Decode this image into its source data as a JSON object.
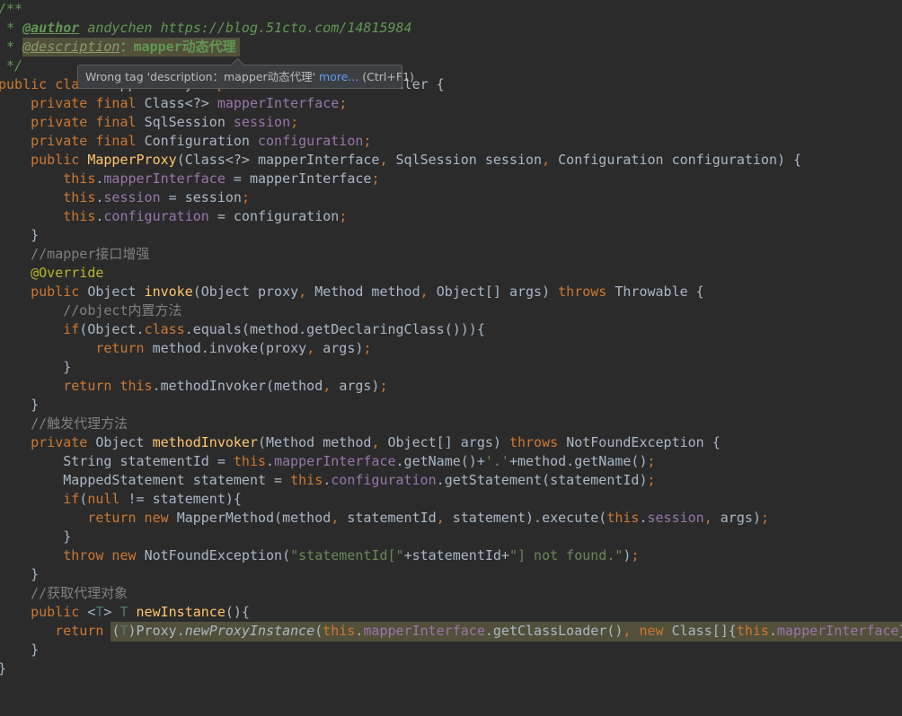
{
  "colors": {
    "background": "#2b2b2b",
    "keyword": "#cc7832",
    "field": "#9876aa",
    "comment": "#808080",
    "doc_comment": "#629755",
    "string": "#6a8759",
    "method_declaration": "#ffc66d",
    "annotation": "#bbb529",
    "text": "#a9b7c6",
    "type_parameter": "#507874",
    "highlight": "#52503a"
  },
  "tooltip": {
    "message": "Wrong tag 'description：mapper动态代理' ",
    "more_link": "more...",
    "shortcut": " (Ctrl+F1)"
  },
  "code_lines": [
    [
      [
        "doc",
        "/**"
      ]
    ],
    [
      [
        "doc",
        " * "
      ],
      [
        "doctag",
        "@author"
      ],
      [
        "doc",
        " andychen https://blog.51cto.com/14815984"
      ]
    ],
    [
      [
        "doc",
        " * "
      ],
      [
        "doctagw",
        "@description"
      ],
      [
        "docw",
        "：mapper动态代理"
      ]
    ],
    [
      [
        "doc",
        " */"
      ]
    ],
    [
      [
        "kw",
        "public class "
      ],
      [
        "tx",
        "MapperProxy "
      ],
      [
        "kw",
        "implements "
      ],
      [
        "tx",
        "InvocationHandler {"
      ]
    ],
    [
      [
        "kw",
        "    private final "
      ],
      [
        "tx",
        "Class<?> "
      ],
      [
        "fld",
        "mapperInterface"
      ],
      [
        "kw",
        ";"
      ]
    ],
    [
      [
        "kw",
        "    private final "
      ],
      [
        "tx",
        "SqlSession "
      ],
      [
        "fld",
        "session"
      ],
      [
        "kw",
        ";"
      ]
    ],
    [
      [
        "kw",
        "    private final "
      ],
      [
        "tx",
        "Configuration "
      ],
      [
        "fld",
        "configuration"
      ],
      [
        "kw",
        ";"
      ]
    ],
    [
      [
        "kw",
        "    public "
      ],
      [
        "fn",
        "MapperProxy"
      ],
      [
        "tx",
        "(Class<?> mapperInterface"
      ],
      [
        "kw",
        ", "
      ],
      [
        "tx",
        "SqlSession session"
      ],
      [
        "kw",
        ", "
      ],
      [
        "tx",
        "Configuration configuration) {"
      ]
    ],
    [
      [
        "kw",
        "        this"
      ],
      [
        "tx",
        "."
      ],
      [
        "fld",
        "mapperInterface "
      ],
      [
        "tx",
        "= mapperInterface"
      ],
      [
        "kw",
        ";"
      ]
    ],
    [
      [
        "kw",
        "        this"
      ],
      [
        "tx",
        "."
      ],
      [
        "fld",
        "session "
      ],
      [
        "tx",
        "= session"
      ],
      [
        "kw",
        ";"
      ]
    ],
    [
      [
        "kw",
        "        this"
      ],
      [
        "tx",
        "."
      ],
      [
        "fld",
        "configuration "
      ],
      [
        "tx",
        "= configuration"
      ],
      [
        "kw",
        ";"
      ]
    ],
    [
      [
        "tx",
        "    }"
      ]
    ],
    [
      [
        "cm",
        "    //mapper接口增强"
      ]
    ],
    [
      [
        "ann",
        "    @Override"
      ]
    ],
    [
      [
        "kw",
        "    public "
      ],
      [
        "tx",
        "Object "
      ],
      [
        "fn",
        "invoke"
      ],
      [
        "tx",
        "(Object proxy"
      ],
      [
        "kw",
        ", "
      ],
      [
        "tx",
        "Method method"
      ],
      [
        "kw",
        ", "
      ],
      [
        "tx",
        "Object[] args) "
      ],
      [
        "kw",
        "throws "
      ],
      [
        "tx",
        "Throwable {"
      ]
    ],
    [
      [
        "cm",
        "        //object内置方法"
      ]
    ],
    [
      [
        "kw",
        "        if"
      ],
      [
        "tx",
        "(Object."
      ],
      [
        "kw",
        "class"
      ],
      [
        "tx",
        ".equals(method.getDeclaringClass())){"
      ]
    ],
    [
      [
        "kw",
        "            return "
      ],
      [
        "tx",
        "method.invoke(proxy"
      ],
      [
        "kw",
        ", "
      ],
      [
        "tx",
        "args)"
      ],
      [
        "kw",
        ";"
      ]
    ],
    [
      [
        "tx",
        "        }"
      ]
    ],
    [
      [
        "kw",
        "        return this"
      ],
      [
        "tx",
        ".methodInvoker(method"
      ],
      [
        "kw",
        ", "
      ],
      [
        "tx",
        "args)"
      ],
      [
        "kw",
        ";"
      ]
    ],
    [
      [
        "tx",
        "    }"
      ]
    ],
    [
      [
        "cm",
        "    //触发代理方法"
      ]
    ],
    [
      [
        "kw",
        "    private "
      ],
      [
        "tx",
        "Object "
      ],
      [
        "fn",
        "methodInvoker"
      ],
      [
        "tx",
        "(Method method"
      ],
      [
        "kw",
        ", "
      ],
      [
        "tx",
        "Object[] args) "
      ],
      [
        "kw",
        "throws "
      ],
      [
        "tx",
        "NotFoundException {"
      ]
    ],
    [
      [
        "tx",
        "        String statementId = "
      ],
      [
        "kw",
        "this"
      ],
      [
        "tx",
        "."
      ],
      [
        "fld",
        "mapperInterface"
      ],
      [
        "tx",
        ".getName()+"
      ],
      [
        "str",
        "'.'"
      ],
      [
        "tx",
        "+method.getName()"
      ],
      [
        "kw",
        ";"
      ]
    ],
    [
      [
        "tx",
        "        MappedStatement statement = "
      ],
      [
        "kw",
        "this"
      ],
      [
        "tx",
        "."
      ],
      [
        "fld",
        "configuration"
      ],
      [
        "tx",
        ".getStatement(statementId)"
      ],
      [
        "kw",
        ";"
      ]
    ],
    [
      [
        "kw",
        "        if"
      ],
      [
        "tx",
        "("
      ],
      [
        "kw",
        "null "
      ],
      [
        "tx",
        "!= statement){"
      ]
    ],
    [
      [
        "kw",
        "           return new "
      ],
      [
        "tx",
        "MapperMethod(method"
      ],
      [
        "kw",
        ", "
      ],
      [
        "tx",
        "statementId"
      ],
      [
        "kw",
        ", "
      ],
      [
        "tx",
        "statement).execute("
      ],
      [
        "kw",
        "this"
      ],
      [
        "tx",
        "."
      ],
      [
        "fld",
        "session"
      ],
      [
        "kw",
        ", "
      ],
      [
        "tx",
        "args)"
      ],
      [
        "kw",
        ";"
      ]
    ],
    [
      [
        "tx",
        "        }"
      ]
    ],
    [
      [
        "kw",
        "        throw new "
      ],
      [
        "tx",
        "NotFoundException("
      ],
      [
        "str",
        "\"statementId[\""
      ],
      [
        "tx",
        "+statementId+"
      ],
      [
        "str",
        "\"] not found.\""
      ],
      [
        "tx",
        ")"
      ],
      [
        "kw",
        ";"
      ]
    ],
    [
      [
        "tx",
        "    }"
      ]
    ],
    [
      [
        "cm",
        "    //获取代理对象"
      ]
    ],
    [
      [
        "kw",
        "    public "
      ],
      [
        "tx",
        "<"
      ],
      [
        "tp",
        "T"
      ],
      [
        "tx",
        "> "
      ],
      [
        "tp",
        "T "
      ],
      [
        "fn",
        "newInstance"
      ],
      [
        "tx",
        "(){"
      ]
    ],
    [
      [
        "kw",
        "       return "
      ],
      [
        "tx",
        "("
      ],
      [
        "tp",
        "T"
      ],
      [
        "tx",
        ")Proxy."
      ],
      [
        "it",
        "newProxyInstance"
      ],
      [
        "tx",
        "("
      ],
      [
        "kw",
        "this"
      ],
      [
        "tx",
        "."
      ],
      [
        "fld",
        "mapperInterface"
      ],
      [
        "tx",
        ".getClassLoader()"
      ],
      [
        "kw",
        ", new "
      ],
      [
        "tx",
        "Class[]{"
      ],
      [
        "kw",
        "this"
      ],
      [
        "tx",
        "."
      ],
      [
        "fld",
        "mapperInterface"
      ],
      [
        "tx",
        "}"
      ]
    ],
    [
      [
        "tx",
        "    }"
      ]
    ],
    [
      [
        "tx",
        "}"
      ]
    ]
  ]
}
